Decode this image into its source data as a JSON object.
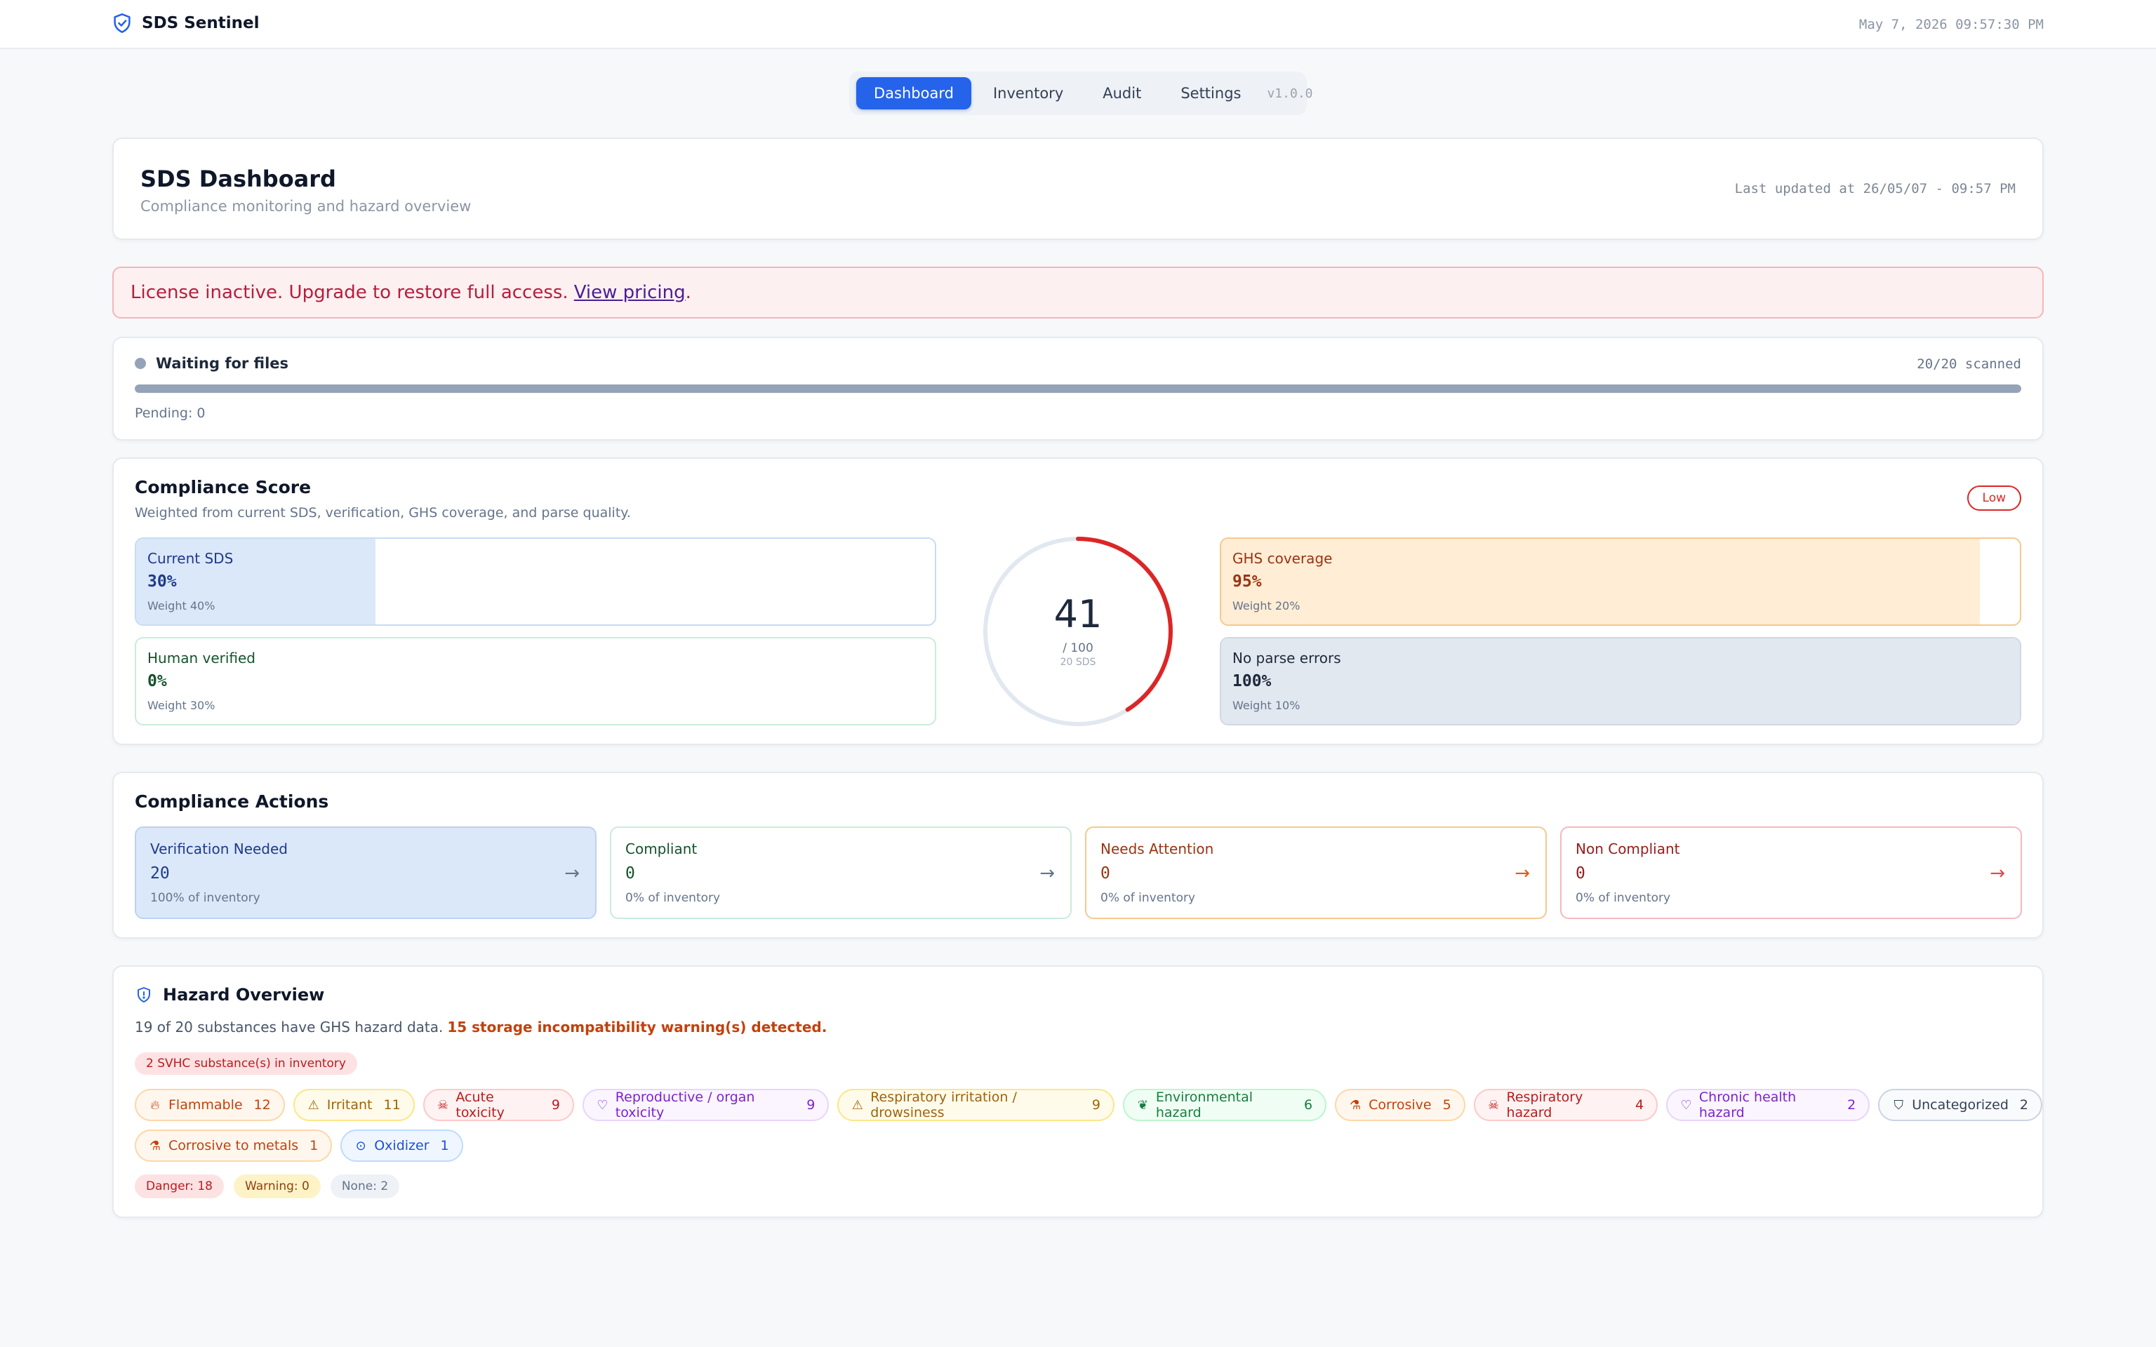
{
  "app": {
    "name": "SDS Sentinel",
    "datetime": "May 7, 2026 09:57:30 PM"
  },
  "tabs": [
    {
      "label": "Dashboard",
      "active": true
    },
    {
      "label": "Inventory",
      "active": false
    },
    {
      "label": "Audit",
      "active": false
    },
    {
      "label": "Settings",
      "active": false
    }
  ],
  "version": "v1.0.0",
  "header": {
    "title": "SDS Dashboard",
    "subtitle": "Compliance monitoring and hazard overview",
    "updated": "Last updated at 26/05/07 - 09:57 PM"
  },
  "license": {
    "message": "License inactive. Upgrade to restore full access.",
    "link": "View pricing",
    "end": "."
  },
  "scan": {
    "status": "Waiting for files",
    "count": "20/20 scanned",
    "pending": "Pending: 0",
    "progress": 1.0
  },
  "score": {
    "title": "Compliance Score",
    "subtitle": "Weighted from current SDS, verification, GHS coverage, and parse quality.",
    "badge": "Low",
    "value": "41",
    "value_num": 41,
    "max_label": "/ 100",
    "count_label": "20 SDS",
    "metrics": {
      "current": {
        "label": "Current SDS",
        "value": "30%",
        "fraction": 0.3,
        "weight": "Weight 40%"
      },
      "human": {
        "label": "Human verified",
        "value": "0%",
        "fraction": 0.0,
        "weight": "Weight 30%"
      },
      "ghs": {
        "label": "GHS coverage",
        "value": "95%",
        "fraction": 0.95,
        "weight": "Weight 20%"
      },
      "parse": {
        "label": "No parse errors",
        "value": "100%",
        "fraction": 1.0,
        "weight": "Weight 10%"
      }
    }
  },
  "actions": {
    "title": "Compliance Actions",
    "items": [
      {
        "label": "Verification Needed",
        "value": "20",
        "pct": "100% of inventory"
      },
      {
        "label": "Compliant",
        "value": "0",
        "pct": "0% of inventory"
      },
      {
        "label": "Needs Attention",
        "value": "0",
        "pct": "0% of inventory"
      },
      {
        "label": "Non Compliant",
        "value": "0",
        "pct": "0% of inventory"
      }
    ],
    "arrow": "→"
  },
  "hazards": {
    "title": "Hazard Overview",
    "summary": "19 of 20 substances have GHS hazard data.",
    "warning": "15 storage incompatibility warning(s) detected.",
    "svhc": "2 SVHC substance(s) in inventory",
    "categories": [
      {
        "label": "Flammable",
        "count": "12",
        "icon": "flame-icon"
      },
      {
        "label": "Irritant",
        "count": "11",
        "icon": "warning-triangle-icon"
      },
      {
        "label": "Acute toxicity",
        "count": "9",
        "icon": "skull-icon"
      },
      {
        "label": "Reproductive / organ toxicity",
        "count": "9",
        "icon": "heart-pulse-icon"
      },
      {
        "label": "Respiratory irritation / drowsiness",
        "count": "9",
        "icon": "warning-triangle-icon"
      },
      {
        "label": "Environmental hazard",
        "count": "6",
        "icon": "leaf-icon"
      },
      {
        "label": "Corrosive",
        "count": "5",
        "icon": "flask-icon"
      },
      {
        "label": "Respiratory hazard",
        "count": "4",
        "icon": "skull-icon"
      },
      {
        "label": "Chronic health hazard",
        "count": "2",
        "icon": "heart-pulse-icon"
      },
      {
        "label": "Uncategorized",
        "count": "2",
        "icon": "shield-icon"
      },
      {
        "label": "Corrosive to metals",
        "count": "1",
        "icon": "flask-icon"
      },
      {
        "label": "Oxidizer",
        "count": "1",
        "icon": "circle-dot-icon"
      }
    ],
    "signal_words": {
      "danger": "Danger: 18",
      "warning": "Warning: 0",
      "none": "None: 2"
    }
  },
  "colors": {
    "accent": "#2563eb",
    "danger": "#dc2626",
    "gauge_track": "#e2e8f0"
  }
}
